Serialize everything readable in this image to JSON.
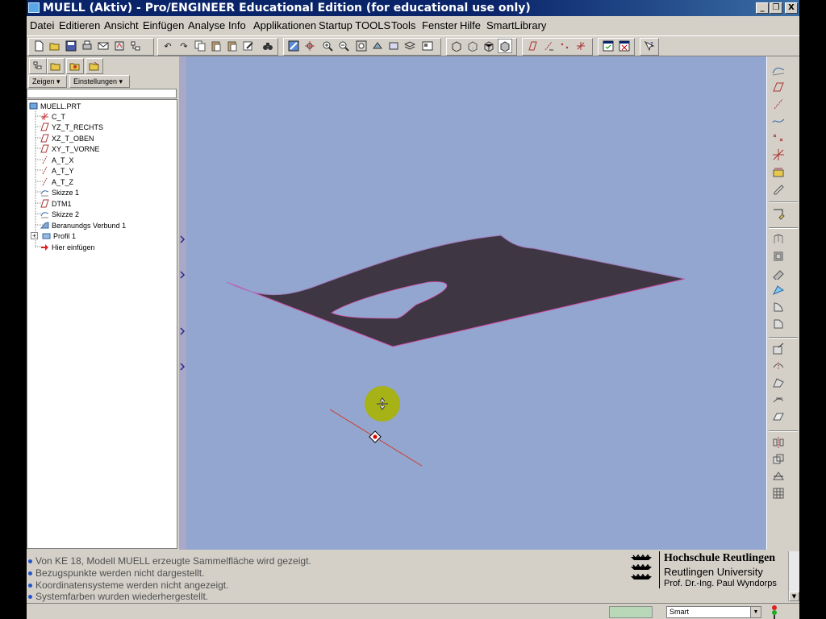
{
  "window": {
    "title": "MUELL (Aktiv) - Pro/ENGINEER Educational Edition (for educational use only)",
    "controls": [
      "_",
      "❐",
      "X"
    ]
  },
  "menu": [
    "Datei",
    "Editieren",
    "Ansicht",
    "Einfügen",
    "Analyse",
    "Info",
    "Applikationen",
    "Startup TOOLS",
    "Tools",
    "Fenster",
    "Hilfe",
    "SmartLibrary"
  ],
  "left_panel": {
    "show_button": "Zeigen ▾",
    "settings_button": "Einstellungen ▾",
    "tree_root": "MUELL.PRT",
    "tree_items": [
      {
        "label": "C_T",
        "icon": "coord-system-icon"
      },
      {
        "label": "YZ_T_RECHTS",
        "icon": "datum-plane-icon"
      },
      {
        "label": "XZ_T_OBEN",
        "icon": "datum-plane-icon"
      },
      {
        "label": "XY_T_VORNE",
        "icon": "datum-plane-icon"
      },
      {
        "label": "A_T_X",
        "icon": "datum-axis-icon"
      },
      {
        "label": "A_T_Y",
        "icon": "datum-axis-icon"
      },
      {
        "label": "A_T_Z",
        "icon": "datum-axis-icon"
      },
      {
        "label": "Skizze 1",
        "icon": "sketch-icon"
      },
      {
        "label": "DTM1",
        "icon": "datum-plane-icon"
      },
      {
        "label": "Skizze 2",
        "icon": "sketch-icon"
      },
      {
        "label": "Beranundgs Verbund 1",
        "icon": "boundary-blend-icon"
      },
      {
        "label": "Profil 1",
        "icon": "profile-icon"
      },
      {
        "label": "Hier einfügen",
        "icon": "insert-here-arrow-icon"
      }
    ]
  },
  "messages": [
    "Von KE 18, Modell MUELL erzeugte Sammelfläche wird gezeigt.",
    "Bezugspunkte werden nicht dargestellt.",
    "Koordinatensysteme werden nicht angezeigt.",
    "Systemfarben wurden wiederhergestellt."
  ],
  "logo": {
    "line1": "Hochschule Reutlingen",
    "line2": "Reutlingen University",
    "line3": "Prof. Dr.-Ing. Paul Wyndorps"
  },
  "status": {
    "filter_value": "Smart"
  },
  "colors": {
    "viewport_bg": "#93a6cf",
    "surface": "#3e3642",
    "surface_edge": "#d14ea8",
    "axis_line": "#d03a2a",
    "cursor_highlight": "#a8b400"
  }
}
